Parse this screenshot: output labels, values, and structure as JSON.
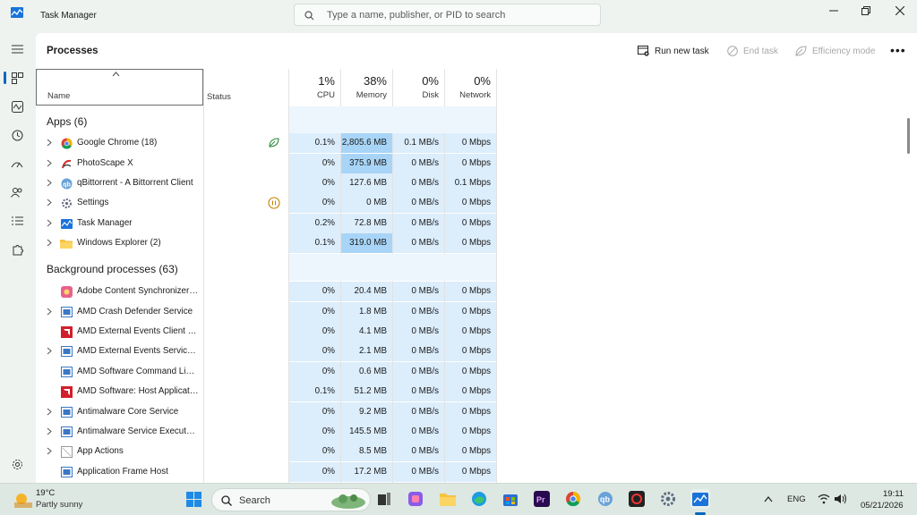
{
  "window": {
    "title": "Task Manager",
    "search_placeholder": "Type a name, publisher, or PID to search"
  },
  "toolbar": {
    "page_title": "Processes",
    "run_new_task": "Run new task",
    "end_task": "End task",
    "efficiency_mode": "Efficiency mode",
    "more": "•••"
  },
  "columns": {
    "name": "Name",
    "status": "Status",
    "cpu_pct": "1%",
    "cpu": "CPU",
    "memory_pct": "38%",
    "memory": "Memory",
    "disk_pct": "0%",
    "disk": "Disk",
    "network_pct": "0%",
    "network": "Network"
  },
  "groups": {
    "apps": "Apps (6)",
    "background": "Background processes (63)"
  },
  "apps": [
    {
      "name": "Google Chrome (18)",
      "cpu": "0.1%",
      "mem": "2,805.6 MB",
      "disk": "0.1 MB/s",
      "net": "0 Mbps"
    },
    {
      "name": "PhotoScape X",
      "cpu": "0%",
      "mem": "375.9 MB",
      "disk": "0 MB/s",
      "net": "0 Mbps"
    },
    {
      "name": "qBittorrent - A Bittorrent Client",
      "cpu": "0%",
      "mem": "127.6 MB",
      "disk": "0 MB/s",
      "net": "0.1 Mbps"
    },
    {
      "name": "Settings",
      "cpu": "0%",
      "mem": "0 MB",
      "disk": "0 MB/s",
      "net": "0 Mbps"
    },
    {
      "name": "Task Manager",
      "cpu": "0.2%",
      "mem": "72.8 MB",
      "disk": "0 MB/s",
      "net": "0 Mbps"
    },
    {
      "name": "Windows Explorer (2)",
      "cpu": "0.1%",
      "mem": "319.0 MB",
      "disk": "0 MB/s",
      "net": "0 Mbps"
    }
  ],
  "background": [
    {
      "name": "Adobe Content Synchronizer (...",
      "cpu": "0%",
      "mem": "20.4 MB",
      "disk": "0 MB/s",
      "net": "0 Mbps"
    },
    {
      "name": "AMD Crash Defender Service",
      "cpu": "0%",
      "mem": "1.8 MB",
      "disk": "0 MB/s",
      "net": "0 Mbps"
    },
    {
      "name": "AMD External Events Client M...",
      "cpu": "0%",
      "mem": "4.1 MB",
      "disk": "0 MB/s",
      "net": "0 Mbps"
    },
    {
      "name": "AMD External Events Service ...",
      "cpu": "0%",
      "mem": "2.1 MB",
      "disk": "0 MB/s",
      "net": "0 Mbps"
    },
    {
      "name": "AMD Software Command Line...",
      "cpu": "0%",
      "mem": "0.6 MB",
      "disk": "0 MB/s",
      "net": "0 Mbps"
    },
    {
      "name": "AMD Software: Host Applicati...",
      "cpu": "0.1%",
      "mem": "51.2 MB",
      "disk": "0 MB/s",
      "net": "0 Mbps"
    },
    {
      "name": "Antimalware Core Service",
      "cpu": "0%",
      "mem": "9.2 MB",
      "disk": "0 MB/s",
      "net": "0 Mbps"
    },
    {
      "name": "Antimalware Service Executable",
      "cpu": "0%",
      "mem": "145.5 MB",
      "disk": "0 MB/s",
      "net": "0 Mbps"
    },
    {
      "name": "App Actions",
      "cpu": "0%",
      "mem": "8.5 MB",
      "disk": "0 MB/s",
      "net": "0 Mbps"
    },
    {
      "name": "Application Frame Host",
      "cpu": "0%",
      "mem": "17.2 MB",
      "disk": "0 MB/s",
      "net": "0 Mbps"
    }
  ],
  "taskbar": {
    "temp": "19°C",
    "weather": "Partly sunny",
    "search": "Search",
    "lang": "ENG",
    "time": "19:11",
    "date": "05/21/2026"
  },
  "colors": {
    "accent": "#0067c0",
    "cell_light": "#dcedfc",
    "cell_high": "#a8d5f7"
  }
}
